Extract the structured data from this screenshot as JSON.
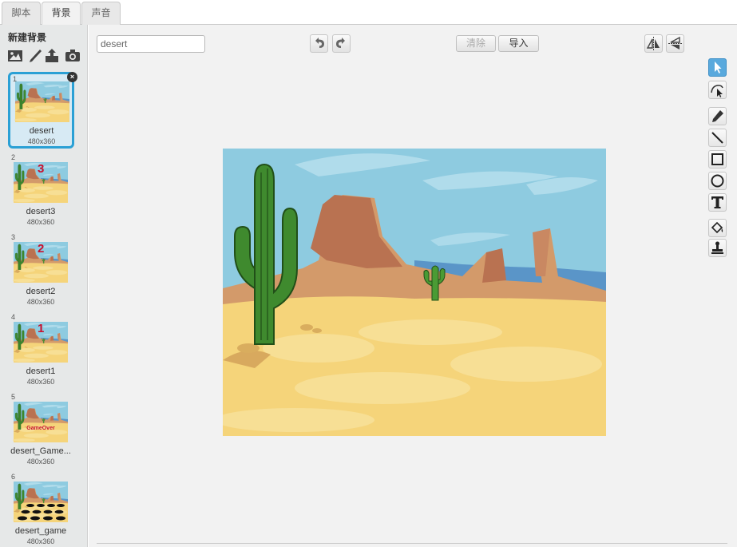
{
  "tabs": [
    {
      "label": "脚本",
      "active": false
    },
    {
      "label": "背景",
      "active": true
    },
    {
      "label": "声音",
      "active": false
    }
  ],
  "sidebar": {
    "new_backdrop_title": "新建背景",
    "new_icons": [
      "paint-from-library-icon",
      "paint-new-icon",
      "upload-icon",
      "camera-icon"
    ],
    "items": [
      {
        "num": "1",
        "name": "desert",
        "size": "480x360",
        "badge": "",
        "selected": true
      },
      {
        "num": "2",
        "name": "desert3",
        "size": "480x360",
        "badge": "3",
        "selected": false
      },
      {
        "num": "3",
        "name": "desert2",
        "size": "480x360",
        "badge": "2",
        "selected": false
      },
      {
        "num": "4",
        "name": "desert1",
        "size": "480x360",
        "badge": "1",
        "selected": false
      },
      {
        "num": "5",
        "name": "desert_Game...",
        "size": "480x360",
        "badge": "GameOver",
        "selected": false
      },
      {
        "num": "6",
        "name": "desert_game",
        "size": "480x360",
        "badge": "",
        "selected": false
      }
    ]
  },
  "editor": {
    "costume_name": "desert",
    "clear_label": "清除",
    "import_label": "导入"
  },
  "colors": {
    "accent": "#2aa0d5",
    "sky": "#8ecbe0",
    "sand": "#f5d47a",
    "cactus": "#3f8a2e"
  },
  "tools": [
    "select-icon",
    "reshape-icon",
    "pencil-icon",
    "line-icon",
    "rectangle-icon",
    "ellipse-icon",
    "text-icon",
    "fill-icon",
    "stamp-icon"
  ]
}
